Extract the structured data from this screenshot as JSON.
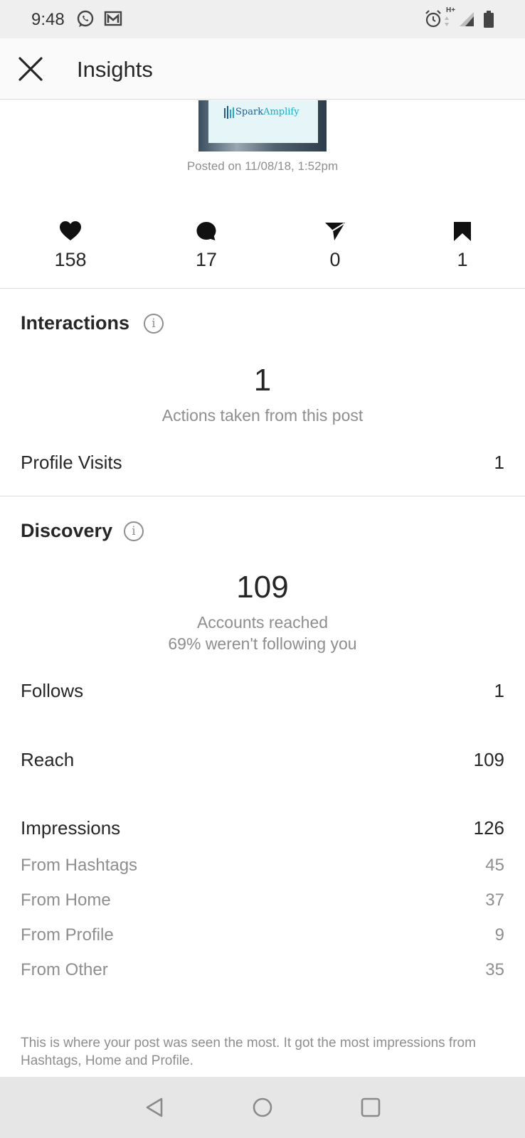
{
  "status_bar": {
    "time": "9:48",
    "network_label": "H+",
    "left_icons": [
      "whatsapp-icon",
      "gmail-icon"
    ],
    "right_icons": [
      "alarm-icon",
      "signal-icon",
      "battery-icon"
    ]
  },
  "app_bar": {
    "title": "Insights",
    "close_icon": "close-icon"
  },
  "post": {
    "brand_text": "Spark",
    "brand_accent": "Amplify",
    "posted_on": "Posted on 11/08/18, 1:52pm"
  },
  "stats": [
    {
      "icon": "heart-icon",
      "value": "158"
    },
    {
      "icon": "comment-icon",
      "value": "17"
    },
    {
      "icon": "share-icon",
      "value": "0"
    },
    {
      "icon": "bookmark-icon",
      "value": "1"
    }
  ],
  "interactions": {
    "title": "Interactions",
    "total": "1",
    "caption": "Actions taken from this post",
    "rows": [
      {
        "label": "Profile Visits",
        "value": "1"
      }
    ]
  },
  "discovery": {
    "title": "Discovery",
    "total": "109",
    "caption": "Accounts reached",
    "caption2": "69% weren't following you",
    "follows": {
      "label": "Follows",
      "value": "1"
    },
    "reach": {
      "label": "Reach",
      "value": "109"
    },
    "impressions": {
      "label": "Impressions",
      "value": "126"
    },
    "breakdown": [
      {
        "label": "From Hashtags",
        "value": "45"
      },
      {
        "label": "From Home",
        "value": "37"
      },
      {
        "label": "From Profile",
        "value": "9"
      },
      {
        "label": "From Other",
        "value": "35"
      }
    ],
    "footnote": "This is where your post was seen the most. It got the most impressions from Hashtags, Home and Profile."
  },
  "nav": {
    "back_icon": "back-triangle-icon",
    "home_icon": "home-circle-icon",
    "recents_icon": "recents-square-icon"
  },
  "colors": {
    "text_primary": "#262626",
    "text_secondary": "#8e8e8e",
    "divider": "#dbdbdb",
    "status_bar": "#efefef",
    "nav_bar": "#e6e6e6"
  }
}
